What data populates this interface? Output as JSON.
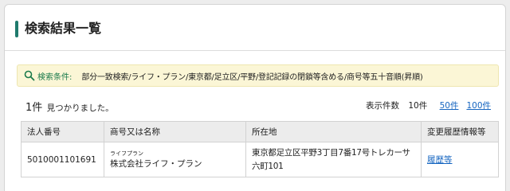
{
  "page": {
    "title": "検索結果一覧"
  },
  "conditions": {
    "label": "検索条件:",
    "value": "部分一致検索/ライフ・プラン/東京都/足立区/平野/登記記録の閉鎖等含める/商号等五十音順(昇順)"
  },
  "results": {
    "count": "1件",
    "count_suffix": "見つかりました。",
    "per_page_label": "表示件数",
    "per_page_current": "10件",
    "per_page_options": [
      "50件",
      "100件"
    ]
  },
  "table": {
    "headers": [
      "法人番号",
      "商号又は名称",
      "所在地",
      "変更履歴情報等"
    ],
    "rows": [
      {
        "corporate_number": "5010001101691",
        "furigana": "ライフプラン",
        "name": "株式会社ライフ・プラン",
        "address": "東京都足立区平野3丁目7番17号トレカーサ六町101",
        "history_link": "履歴等"
      }
    ]
  },
  "colors": {
    "accent": "#1f7a6d",
    "condition_bg": "#fbf6d6",
    "condition_label": "#1a7a4b",
    "link": "#1565c0"
  },
  "icons": {
    "search": "search-icon"
  }
}
